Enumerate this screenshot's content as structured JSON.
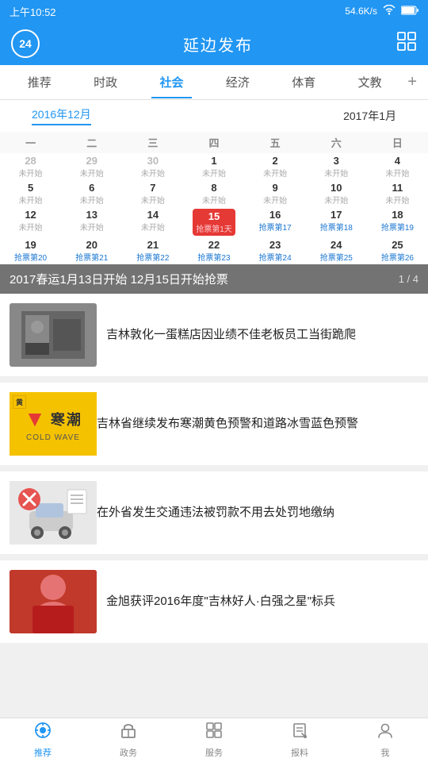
{
  "statusBar": {
    "time": "上午10:52",
    "network": "54.6K/s",
    "signals": "···"
  },
  "header": {
    "badge": "24",
    "title": "延边发布"
  },
  "navTabs": {
    "items": [
      "推荐",
      "时政",
      "社会",
      "经济",
      "体育",
      "文教"
    ],
    "activeIndex": 2
  },
  "calendar": {
    "months": [
      "2016年12月",
      "2017年1月"
    ],
    "activeMonth": 0,
    "weekdays": [
      "一",
      "二",
      "三",
      "四",
      "五",
      "六",
      "日"
    ],
    "rows": [
      [
        {
          "day": "28",
          "sub": "未开始",
          "inactive": true
        },
        {
          "day": "29",
          "sub": "未开始",
          "inactive": true
        },
        {
          "day": "30",
          "sub": "未开始",
          "inactive": true
        },
        {
          "day": "1",
          "sub": "未开始"
        },
        {
          "day": "2",
          "sub": "未开始"
        },
        {
          "day": "3",
          "sub": "未开始"
        },
        {
          "day": "4",
          "sub": "未开始"
        }
      ],
      [
        {
          "day": "5",
          "sub": "未开始"
        },
        {
          "day": "6",
          "sub": "未开始"
        },
        {
          "day": "7",
          "sub": "未开始"
        },
        {
          "day": "8",
          "sub": "未开始"
        },
        {
          "day": "9",
          "sub": "未开始"
        },
        {
          "day": "10",
          "sub": "未开始"
        },
        {
          "day": "11",
          "sub": "未开始"
        }
      ],
      [
        {
          "day": "12",
          "sub": "未开始"
        },
        {
          "day": "13",
          "sub": "未开始"
        },
        {
          "day": "14",
          "sub": "未开始"
        },
        {
          "day": "15",
          "sub": "抢票第1天",
          "highlight": true
        },
        {
          "day": "16",
          "sub": "抢票第17"
        },
        {
          "day": "17",
          "sub": "抢票第18"
        },
        {
          "day": "18",
          "sub": "抢票第19"
        }
      ],
      [
        {
          "day": "19",
          "sub": "抢票第20"
        },
        {
          "day": "20",
          "sub": "抢票第21"
        },
        {
          "day": "21",
          "sub": "抢票第22"
        },
        {
          "day": "22",
          "sub": "抢票第23"
        },
        {
          "day": "23",
          "sub": "抢票第24"
        },
        {
          "day": "24",
          "sub": "抢票第25"
        },
        {
          "day": "25",
          "sub": "抢票第26"
        }
      ]
    ]
  },
  "banner": {
    "text": "2017春运1月13日开始 12月15日开始抢票",
    "page": "1 / 4"
  },
  "newsItems": [
    {
      "id": 1,
      "title": "吉林敦化一蛋糕店因业绩不佳老板员工当街跪爬",
      "thumbType": "photo"
    },
    {
      "id": 2,
      "title": "吉林省继续发布寒潮黄色预警和道路冰雪蓝色预警",
      "thumbType": "coldwave"
    },
    {
      "id": 3,
      "title": "在外省发生交通违法被罚款不用去处罚地缴纳",
      "thumbType": "traffic"
    },
    {
      "id": 4,
      "title": "金旭获评2016年度\"吉林好人·白强之星\"标兵",
      "thumbType": "person"
    }
  ],
  "coldWave": {
    "icon": "▼",
    "label": "寒潮",
    "en": "COLD WAVE",
    "badge": "黄"
  },
  "bottomNav": {
    "items": [
      "推荐",
      "政务",
      "服务",
      "报料",
      "我"
    ],
    "icons": [
      "⊕",
      "⌂",
      "⊞",
      "✎",
      "♟"
    ],
    "activeIndex": 0
  }
}
